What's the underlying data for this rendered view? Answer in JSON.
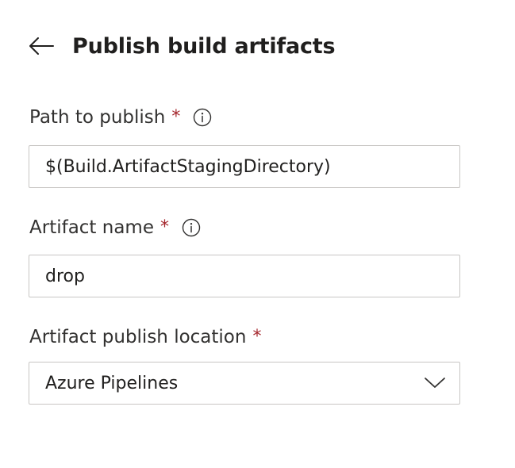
{
  "header": {
    "title": "Publish build artifacts",
    "back_icon": "arrow-left-icon"
  },
  "form": {
    "path_to_publish": {
      "label": "Path to publish",
      "required_marker": "*",
      "info_icon": "info-icon",
      "value": "$(Build.ArtifactStagingDirectory)"
    },
    "artifact_name": {
      "label": "Artifact name",
      "required_marker": "*",
      "info_icon": "info-icon",
      "value": "drop"
    },
    "publish_location": {
      "label": "Artifact publish location",
      "required_marker": "*",
      "selected": "Azure Pipelines",
      "dropdown_icon": "chevron-down-icon"
    }
  },
  "colors": {
    "required": "#a4262c",
    "border": "#c8c6c4",
    "text": "#201f1e"
  }
}
